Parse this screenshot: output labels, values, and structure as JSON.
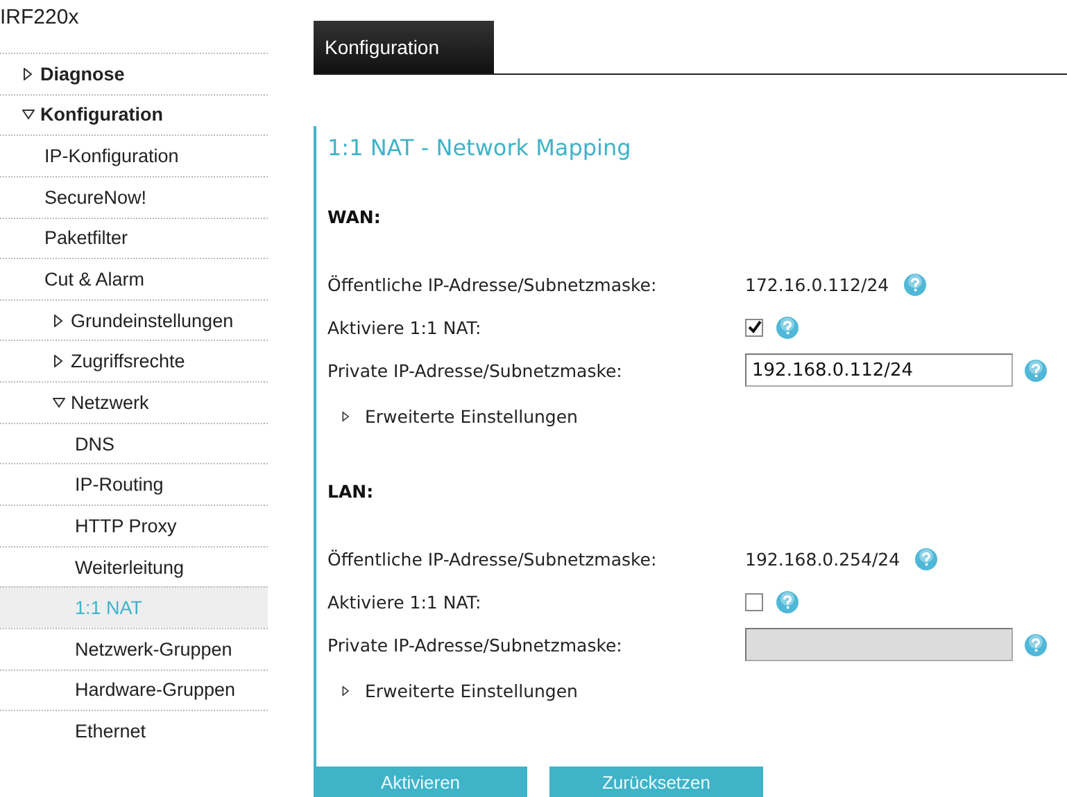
{
  "sidebar": {
    "title": "IRF220x",
    "items": [
      {
        "label": "Diagnose",
        "expanded": false
      },
      {
        "label": "Konfiguration",
        "expanded": true,
        "children": [
          {
            "label": "IP-Konfiguration",
            "selected": false
          },
          {
            "label": "SecureNow!",
            "selected": false
          },
          {
            "label": "Paketfilter",
            "selected": false
          },
          {
            "label": "Cut & Alarm",
            "selected": false
          },
          {
            "label": "Grundeinstellungen",
            "expanded": false
          },
          {
            "label": "Zugriffsrechte",
            "expanded": false
          },
          {
            "label": "Netzwerk",
            "expanded": true,
            "children": [
              {
                "label": "DNS",
                "selected": false
              },
              {
                "label": "IP-Routing",
                "selected": false
              },
              {
                "label": "HTTP Proxy",
                "selected": false
              },
              {
                "label": "Weiterleitung",
                "selected": false
              },
              {
                "label": "1:1 NAT",
                "selected": true
              },
              {
                "label": "Netzwerk-Gruppen",
                "selected": false
              },
              {
                "label": "Hardware-Gruppen",
                "selected": false
              },
              {
                "label": "Ethernet",
                "selected": false
              }
            ]
          }
        ]
      }
    ]
  },
  "tabs": [
    {
      "label": "Konfiguration",
      "selected": true
    }
  ],
  "page_title": "1:1 NAT - Network Mapping",
  "sections": [
    {
      "heading": "WAN:",
      "rows": [
        {
          "kind": "text",
          "label": "Öffentliche IP-Adresse/Subnetzmaske:",
          "value": "172.16.0.112/24"
        },
        {
          "kind": "checkbox",
          "label": "Aktiviere 1:1 NAT:",
          "checked": true
        },
        {
          "kind": "input",
          "label": "Private IP-Adresse/Subnetzmaske:",
          "value": "192.168.0.112/24",
          "disabled": false
        }
      ],
      "advanced": {
        "label": "Erweiterte Einstellungen",
        "expanded": false
      }
    },
    {
      "heading": "LAN:",
      "rows": [
        {
          "kind": "text",
          "label": "Öffentliche IP-Adresse/Subnetzmaske:",
          "value": "192.168.0.254/24"
        },
        {
          "kind": "checkbox",
          "label": "Aktiviere 1:1 NAT:",
          "checked": false
        },
        {
          "kind": "input",
          "label": "Private IP-Adresse/Subnetzmaske:",
          "value": "",
          "disabled": true
        }
      ],
      "advanced": {
        "label": "Erweiterte Einstellungen",
        "expanded": false
      }
    }
  ],
  "buttons": [
    "Aktivieren",
    "Zurücksetzen"
  ]
}
